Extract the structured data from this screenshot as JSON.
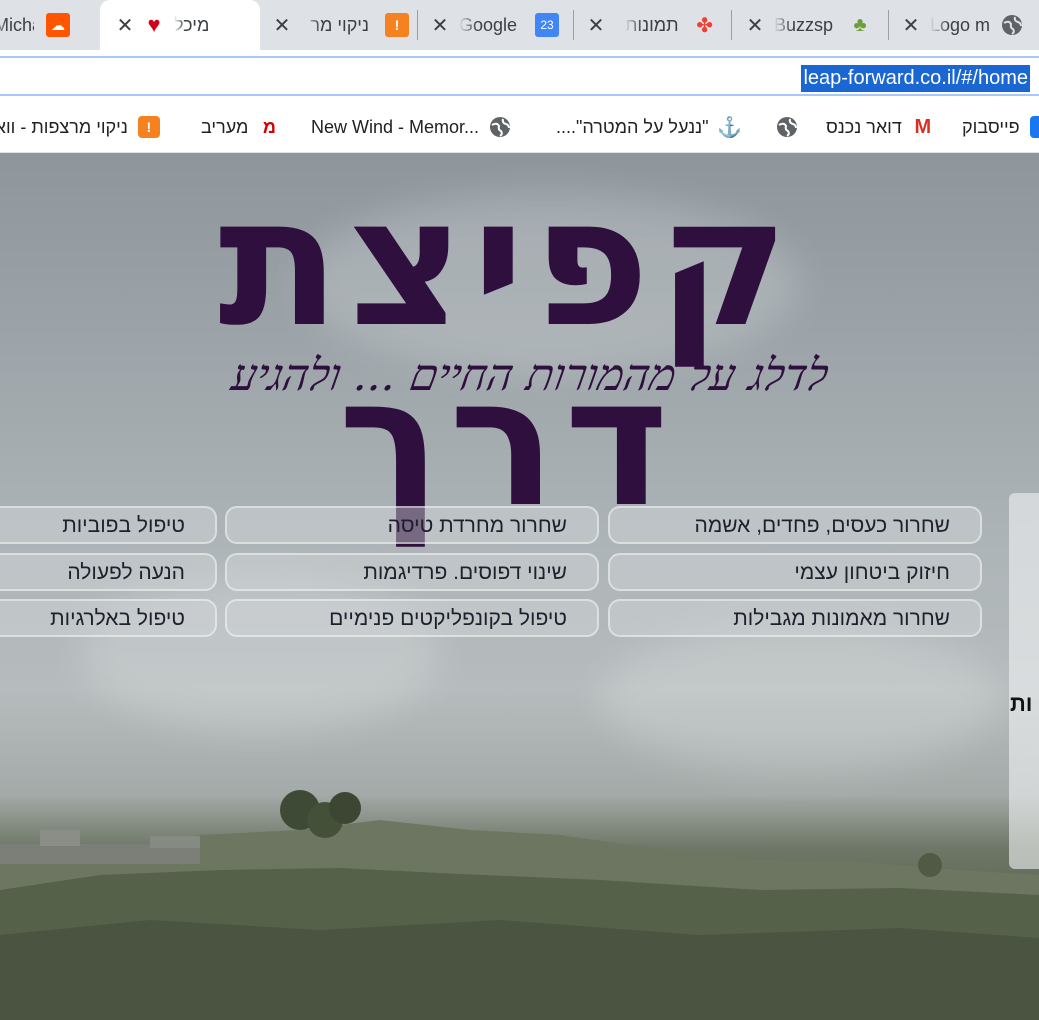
{
  "tabs": [
    {
      "title": "Michal",
      "favicon": "soundcloud-icon",
      "active": false
    },
    {
      "title": "מיכל",
      "favicon": "heart-icon",
      "active": true
    },
    {
      "title": "ניקוי מר",
      "favicon": "exclamation-icon",
      "active": false
    },
    {
      "title": "Google",
      "favicon": "calendar-icon",
      "favicon_text": "23",
      "active": false
    },
    {
      "title": "תמונות",
      "favicon": "pinwheel-icon",
      "active": false
    },
    {
      "title": "Buzzspr",
      "favicon": "person-icon",
      "active": false
    },
    {
      "title": "Logo m",
      "favicon": "globe-icon",
      "active": false
    }
  ],
  "address_bar": {
    "url": "leap-forward.co.il/#/home"
  },
  "bookmarks": [
    {
      "label": "פייסבוק",
      "icon": "facebook-icon"
    },
    {
      "label": "דואר נכנס",
      "icon": "gmail-icon"
    },
    {
      "label": "\"ננעל על המטרה\"....",
      "icon": "globe-icon"
    },
    {
      "label": "",
      "icon": "anchor-icon"
    },
    {
      "label": "New Wind - Memor...",
      "icon": "globe-icon"
    },
    {
      "label": "מעריב",
      "icon": "maariv-icon",
      "icon_text": "מ"
    },
    {
      "label": "ניקוי מרצפות - וואו",
      "icon": "exclamation-icon"
    }
  ],
  "hero": {
    "logo_text": "קפיצת דרך",
    "tagline": "לדלג על מהמורות החיים ... ולהגיע"
  },
  "service_buttons": [
    [
      "שחרור כעסים, פחדים, אשמה",
      "שחרור מחרדת טיסה",
      "טיפול בפוביות"
    ],
    [
      "חיזוק ביטחון עצמי",
      "שינוי דפוסים. פרדיגמות",
      "הנעה לפעולה"
    ],
    [
      "שחרור מאמונות מגבילות",
      "טיפול בקונפליקטים פנימיים",
      "טיפול באלרגיות"
    ]
  ],
  "side_panel": {
    "text": "ות"
  },
  "colors": {
    "brand_purple": "#2e0f3d",
    "selection_blue": "#1a66d2",
    "tab_strip": "#dee1e6"
  }
}
